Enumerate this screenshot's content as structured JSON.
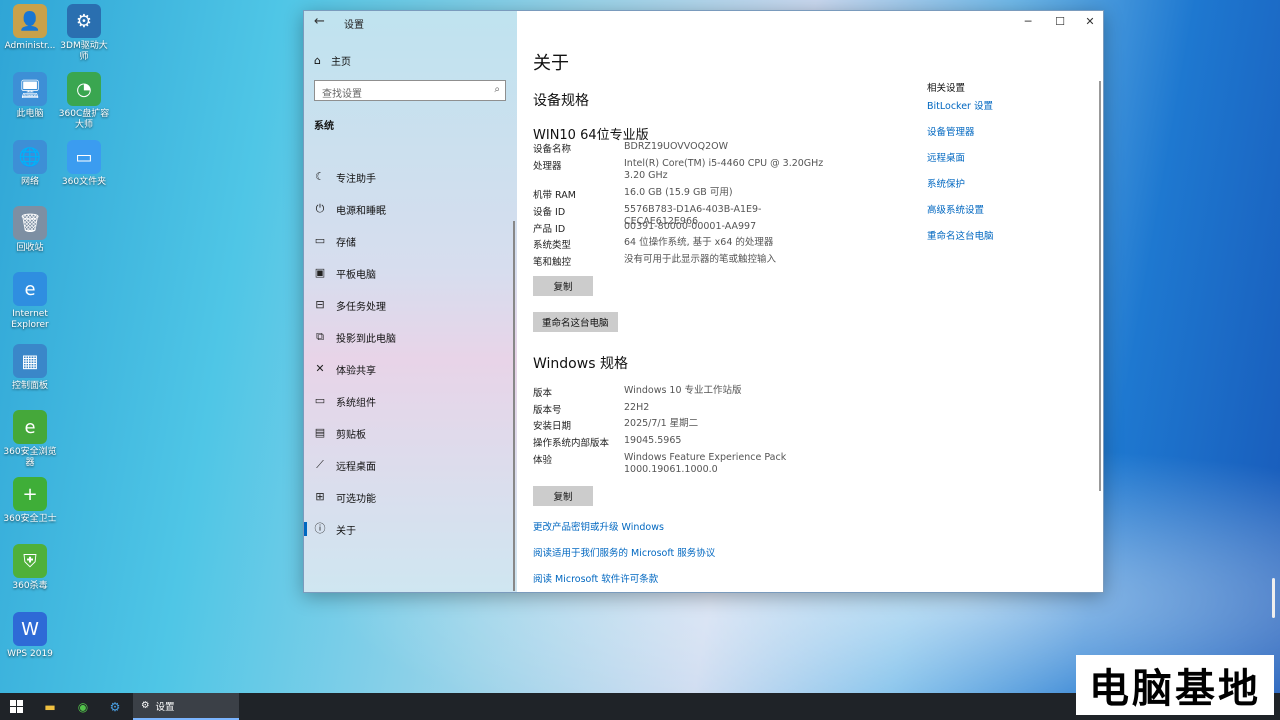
{
  "desktop": {
    "icons": [
      {
        "label": "Administr...",
        "glyph": "👤",
        "bg": "#c9a14a"
      },
      {
        "label": "3DM驱动大师",
        "glyph": "⚙",
        "bg": "#2a6fb0"
      },
      {
        "label": "此电脑",
        "glyph": "🖥",
        "bg": "#3d8fd6"
      },
      {
        "label": "360C盘扩容大师",
        "glyph": "◔",
        "bg": "#3aa650"
      },
      {
        "label": "网络",
        "glyph": "🌐",
        "bg": "#3d8fd6"
      },
      {
        "label": "360文件夹",
        "glyph": "▭",
        "bg": "#3b9cf0"
      },
      {
        "label": "回收站",
        "glyph": "🗑",
        "bg": "#7d8fa3"
      },
      {
        "label": "Internet Explorer",
        "glyph": "e",
        "bg": "#2f8ee0"
      },
      {
        "label": "控制面板",
        "glyph": "▦",
        "bg": "#3a87c9"
      },
      {
        "label": "360安全浏览器",
        "glyph": "e",
        "bg": "#45a83a"
      },
      {
        "label": "360安全卫士",
        "glyph": "+",
        "bg": "#3fae38"
      },
      {
        "label": "360杀毒",
        "glyph": "⛨",
        "bg": "#4fb03a"
      },
      {
        "label": "WPS 2019",
        "glyph": "W",
        "bg": "#2e6ad6"
      }
    ]
  },
  "window": {
    "title": "设置",
    "controls": {
      "minimize": "─",
      "maximize": "☐",
      "close": "✕"
    },
    "nav": {
      "home": "主页",
      "search_placeholder": "查找设置",
      "group": "系统",
      "items": [
        {
          "label": "专注助手",
          "icon": "moon-icon",
          "glyph": "☾"
        },
        {
          "label": "电源和睡眠",
          "icon": "power-icon",
          "glyph": "⏻"
        },
        {
          "label": "存储",
          "icon": "storage-icon",
          "glyph": "▭"
        },
        {
          "label": "平板电脑",
          "icon": "tablet-icon",
          "glyph": "▣"
        },
        {
          "label": "多任务处理",
          "icon": "multitask-icon",
          "glyph": "⊟"
        },
        {
          "label": "投影到此电脑",
          "icon": "project-icon",
          "glyph": "⧉"
        },
        {
          "label": "体验共享",
          "icon": "share-icon",
          "glyph": "✕"
        },
        {
          "label": "系统组件",
          "icon": "components-icon",
          "glyph": "▭"
        },
        {
          "label": "剪贴板",
          "icon": "clipboard-icon",
          "glyph": "▤"
        },
        {
          "label": "远程桌面",
          "icon": "remote-icon",
          "glyph": "⟋"
        },
        {
          "label": "可选功能",
          "icon": "optional-icon",
          "glyph": "⊞"
        },
        {
          "label": "关于",
          "icon": "info-icon",
          "glyph": "ⓘ",
          "active": true
        }
      ]
    },
    "content": {
      "page_title": "关于",
      "device_specs_title": "设备规格",
      "device_name": "WIN10 64位专业版",
      "device_specs": [
        {
          "k": "设备名称",
          "v": "BDRZ19UOVVOQ2OW"
        },
        {
          "k": "处理器",
          "v": "Intel(R) Core(TM) i5-4460  CPU @ 3.20GHz   3.20 GHz"
        },
        {
          "k": "机带 RAM",
          "v": "16.0 GB (15.9 GB 可用)"
        },
        {
          "k": "设备 ID",
          "v": "5576B783-D1A6-403B-A1E9-CECAE612E966"
        },
        {
          "k": "产品 ID",
          "v": "00391-80000-00001-AA997"
        },
        {
          "k": "系统类型",
          "v": "64 位操作系统, 基于 x64 的处理器"
        },
        {
          "k": "笔和触控",
          "v": "没有可用于此显示器的笔或触控输入"
        }
      ],
      "copy_label": "复制",
      "rename_label": "重命名这台电脑",
      "windows_specs_title": "Windows 规格",
      "windows_specs": [
        {
          "k": "版本",
          "v": "Windows 10 专业工作站版"
        },
        {
          "k": "版本号",
          "v": "22H2"
        },
        {
          "k": "安装日期",
          "v": "2025/7/1 星期二"
        },
        {
          "k": "操作系统内部版本",
          "v": "19045.5965"
        },
        {
          "k": "体验",
          "v": "Windows Feature Experience Pack 1000.19061.1000.0"
        }
      ],
      "links": [
        "更改产品密钥或升级 Windows",
        "阅读适用于我们服务的 Microsoft 服务协议",
        "阅读 Microsoft 软件许可条款"
      ],
      "related_title": "相关设置",
      "related": [
        "BitLocker 设置",
        "设备管理器",
        "远程桌面",
        "系统保护",
        "高级系统设置",
        "重命名这台电脑"
      ]
    }
  },
  "taskbar": {
    "active_app": "设置"
  },
  "watermark": "电脑基地"
}
